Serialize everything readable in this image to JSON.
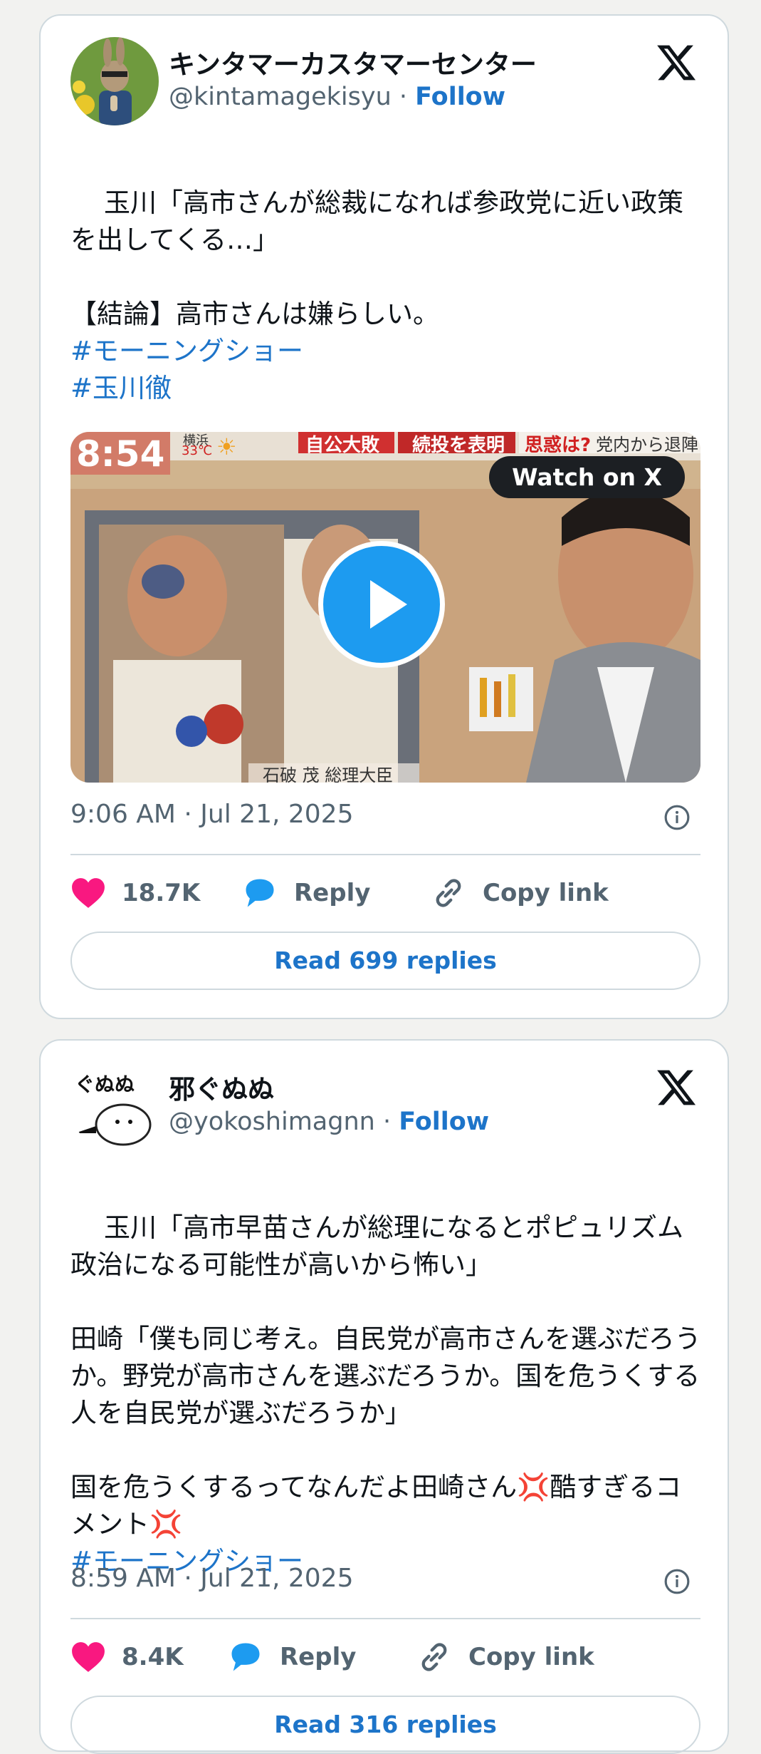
{
  "tweets": [
    {
      "display_name": "キンタマーカスタマーセンター",
      "handle": "@kintamagekisyu",
      "separator": " · ",
      "follow_label": "Follow",
      "body": "玉川「高市さんが総裁になれば参政党に近い政策を出してくる…」\n\n【結論】高市さんは嫌らしい。\n",
      "hashtags": [
        "#モーニングショー",
        "#玉川徹"
      ],
      "media": {
        "watch_label": "Watch on X",
        "tv_clock": "8:54",
        "tv_temp": "33℃",
        "tv_city": "横浜",
        "tv_banners": [
          "自公大敗",
          "続投を表明",
          "思惑は?",
          "党内から退陣"
        ],
        "tv_caption": "石破 茂 総理大臣"
      },
      "timestamp": "9:06 AM · Jul 21, 2025",
      "likes": "18.7K",
      "reply_label": "Reply",
      "copy_label": "Copy link",
      "read_replies": "Read 699 replies"
    },
    {
      "display_name": "邪ぐぬぬ",
      "avatar_text": "ぐぬぬ",
      "handle": "@yokoshimagnn",
      "separator": " · ",
      "follow_label": "Follow",
      "body": "玉川「高市早苗さんが総理になるとポピュリズム政治になる可能性が高いから怖い」\n\n田崎「僕も同じ考え。自民党が高市さんを選ぶだろうか。野党が高市さんを選ぶだろうか。国を危うくする人を自民党が選ぶだろうか」\n\n国を危うくするってなんだよ田崎さん💢酷すぎるコメント💢",
      "hashtags": [
        "#モーニングショー"
      ],
      "timestamp": "8:59 AM · Jul 21, 2025",
      "likes": "8.4K",
      "reply_label": "Reply",
      "copy_label": "Copy link",
      "read_replies": "Read 316 replies"
    }
  ],
  "colors": {
    "link": "#1d74c9",
    "heart": "#f91880",
    "reply_icon": "#1d9bf0",
    "muted": "#536471",
    "border": "#cfd9de"
  }
}
